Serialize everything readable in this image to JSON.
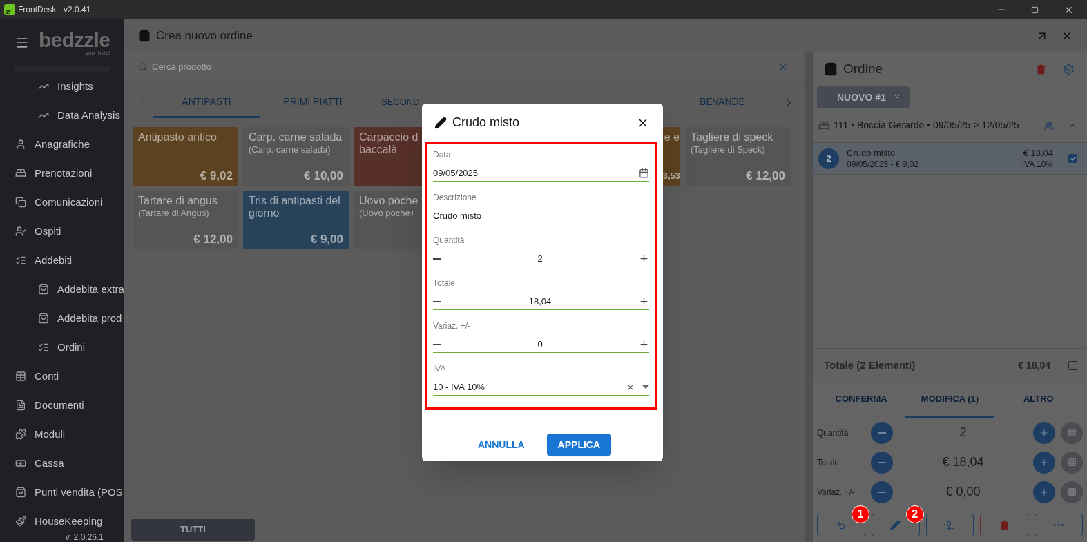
{
  "window": {
    "title": "FrontDesk - v2.0.41"
  },
  "sidebar": {
    "logo": "bedzzle",
    "logo_tagline": "your hotel",
    "partial_children": [
      {
        "label": "Insights"
      },
      {
        "label": "Data Analysis"
      }
    ],
    "items": [
      {
        "label": "Anagrafiche"
      },
      {
        "label": "Prenotazioni"
      },
      {
        "label": "Comunicazioni"
      },
      {
        "label": "Ospiti"
      },
      {
        "label": "Addebiti",
        "children": [
          {
            "label": "Addebita extra"
          },
          {
            "label": "Addebita prod"
          },
          {
            "label": "Ordini"
          }
        ]
      },
      {
        "label": "Conti"
      },
      {
        "label": "Documenti"
      },
      {
        "label": "Moduli"
      },
      {
        "label": "Cassa"
      },
      {
        "label": "Punti vendita (POS"
      },
      {
        "label": "HouseKeeping"
      }
    ],
    "version": "v. 2.0.26.1"
  },
  "panel": {
    "title": "Crea nuovo ordine",
    "search": {
      "placeholder": "Cerca prodotto"
    },
    "categories": [
      {
        "label": "ANTIPASTI",
        "selected": true
      },
      {
        "label": "PRIMI PIATTI",
        "selected": false
      },
      {
        "label": "SECOND",
        "selected": false
      },
      {
        "label": "BEVANDE",
        "selected": false
      }
    ],
    "products": [
      {
        "kind": "card",
        "name": "Antipasto antico",
        "price": "€ 9,02",
        "color": "#5c4220"
      },
      {
        "kind": "card",
        "name": "Carp. carne salada",
        "subtitle": "(Carp. carne salada)",
        "price": "€ 10,00",
        "color": "#555555"
      },
      {
        "kind": "card",
        "name": "Carpaccio d\nbaccalà",
        "color": "#58302a"
      },
      {
        "kind": "covered"
      },
      {
        "kind": "partial",
        "name": "e e",
        "price": "3,53",
        "color": "#5c4220"
      },
      {
        "kind": "card",
        "name": "Tagliere di speck",
        "subtitle": "(Tagliere di Speck)",
        "price": "€ 12,00",
        "color": "#555555"
      },
      {
        "kind": "card",
        "name": "Tartare di angus",
        "subtitle": "(Tartare di Angus)",
        "price": "€ 12,00",
        "color": "#555555"
      },
      {
        "kind": "card",
        "name": "Tris di antipasti del giorno",
        "price": "€ 9,00",
        "color": "#28425a"
      },
      {
        "kind": "card",
        "name": "Uovo poche",
        "subtitle": "(Uovo poche+",
        "color": "#555555"
      }
    ],
    "filter_button": "TUTTI"
  },
  "order": {
    "title": "Ordine",
    "chips": [
      {
        "label": "NUOVO #1",
        "selected": true
      }
    ],
    "guest": "111 • Boccia Gerardo • 09/05/25 > 12/05/25",
    "lines": [
      {
        "qty": "2",
        "name": "Crudo misto",
        "detail": "09/05/2025 - € 9,02",
        "amount": "€ 18,04",
        "vat": "IVA 10%",
        "checked": true
      }
    ],
    "total": {
      "label": "Totale (2 Elementi)",
      "amount": "€ 18,04",
      "checked": false
    },
    "tabs": [
      {
        "label": "CONFERMA",
        "selected": false
      },
      {
        "label": "MODIFICA (1)",
        "selected": true
      },
      {
        "label": "ALTRO",
        "selected": false
      }
    ],
    "adjusters": [
      {
        "label": "Quantità",
        "value": "2"
      },
      {
        "label": "Totale",
        "value": "€ 18,04"
      },
      {
        "label": "Variaz. +/-",
        "value": "€ 0,00"
      }
    ],
    "actions": [
      {
        "kind": "undo",
        "badge": "1"
      },
      {
        "kind": "edit",
        "badge": "2"
      },
      {
        "kind": "decimal"
      },
      {
        "kind": "delete"
      },
      {
        "kind": "more"
      }
    ]
  },
  "dialog": {
    "title": "Crudo misto",
    "fields": [
      {
        "kind": "date",
        "label": "Data",
        "value": "09/05/2025"
      },
      {
        "kind": "text",
        "label": "Descrizione",
        "value": "Crudo misto"
      },
      {
        "kind": "number",
        "label": "Quantità",
        "value": "2"
      },
      {
        "kind": "number",
        "label": "Totale",
        "value": "18,04"
      },
      {
        "kind": "number",
        "label": "Variaz. +/-",
        "value": "0"
      },
      {
        "kind": "select",
        "label": "IVA",
        "value": "10 - IVA 10%"
      }
    ],
    "buttons": [
      {
        "kind": "text",
        "label": "ANNULLA"
      },
      {
        "kind": "primary",
        "label": "APPLICA"
      }
    ]
  }
}
